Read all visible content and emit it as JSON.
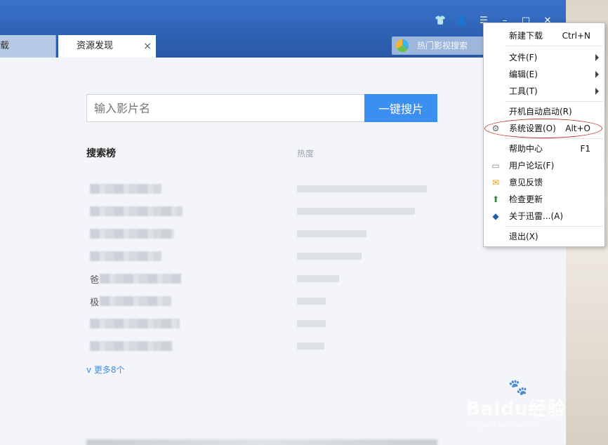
{
  "tabs": {
    "prev_label": "载",
    "active_label": "资源发现",
    "close_glyph": "×"
  },
  "hot_search": {
    "placeholder": "热门影视搜索"
  },
  "search": {
    "placeholder": "输入影片名",
    "button_label": "一键搜片"
  },
  "ranking": {
    "title": "搜索榜",
    "heat_label": "热度",
    "rows": [
      {
        "name_prefix": "",
        "heat": 0.95
      },
      {
        "name_prefix": "",
        "heat": 0.86
      },
      {
        "name_prefix": "",
        "heat": 0.51
      },
      {
        "name_prefix": "",
        "heat": 0.47
      },
      {
        "name_prefix": "爸",
        "heat": 0.31
      },
      {
        "name_prefix": "极",
        "heat": 0.21
      },
      {
        "name_prefix": "",
        "heat": 0.21
      },
      {
        "name_prefix": "",
        "heat": 0.2
      }
    ],
    "more_label": "v 更多8个"
  },
  "menu": {
    "items": [
      {
        "label": "新建下载",
        "shortcut": "Ctrl+N",
        "icon": "",
        "submenu": false
      },
      {
        "label": "文件(F)",
        "shortcut": "",
        "icon": "",
        "submenu": true
      },
      {
        "label": "编辑(E)",
        "shortcut": "",
        "icon": "",
        "submenu": true
      },
      {
        "label": "工具(T)",
        "shortcut": "",
        "icon": "",
        "submenu": true
      },
      {
        "label": "开机自动启动(R)",
        "shortcut": "",
        "icon": "",
        "submenu": false
      },
      {
        "label": "系统设置(O)",
        "shortcut": "Alt+O",
        "icon": "gear-icon",
        "submenu": false
      },
      {
        "label": "帮助中心",
        "shortcut": "F1",
        "icon": "",
        "submenu": false
      },
      {
        "label": "用户论坛(F)",
        "shortcut": "",
        "icon": "forum-icon",
        "submenu": false
      },
      {
        "label": "意见反馈",
        "shortcut": "",
        "icon": "envelope-icon",
        "submenu": false
      },
      {
        "label": "检查更新",
        "shortcut": "",
        "icon": "update-icon",
        "submenu": false
      },
      {
        "label": "关于迅雷...(A)",
        "shortcut": "",
        "icon": "thunder-icon",
        "submenu": false
      },
      {
        "label": "退出(X)",
        "shortcut": "",
        "icon": "",
        "submenu": false
      }
    ]
  },
  "watermark": {
    "main": "Baidu经验",
    "sub": "jingyan.baidu.com"
  },
  "colors": {
    "titlebar": "#2f63b7",
    "accent": "#3b8ff0",
    "highlight": "#c0392b"
  }
}
